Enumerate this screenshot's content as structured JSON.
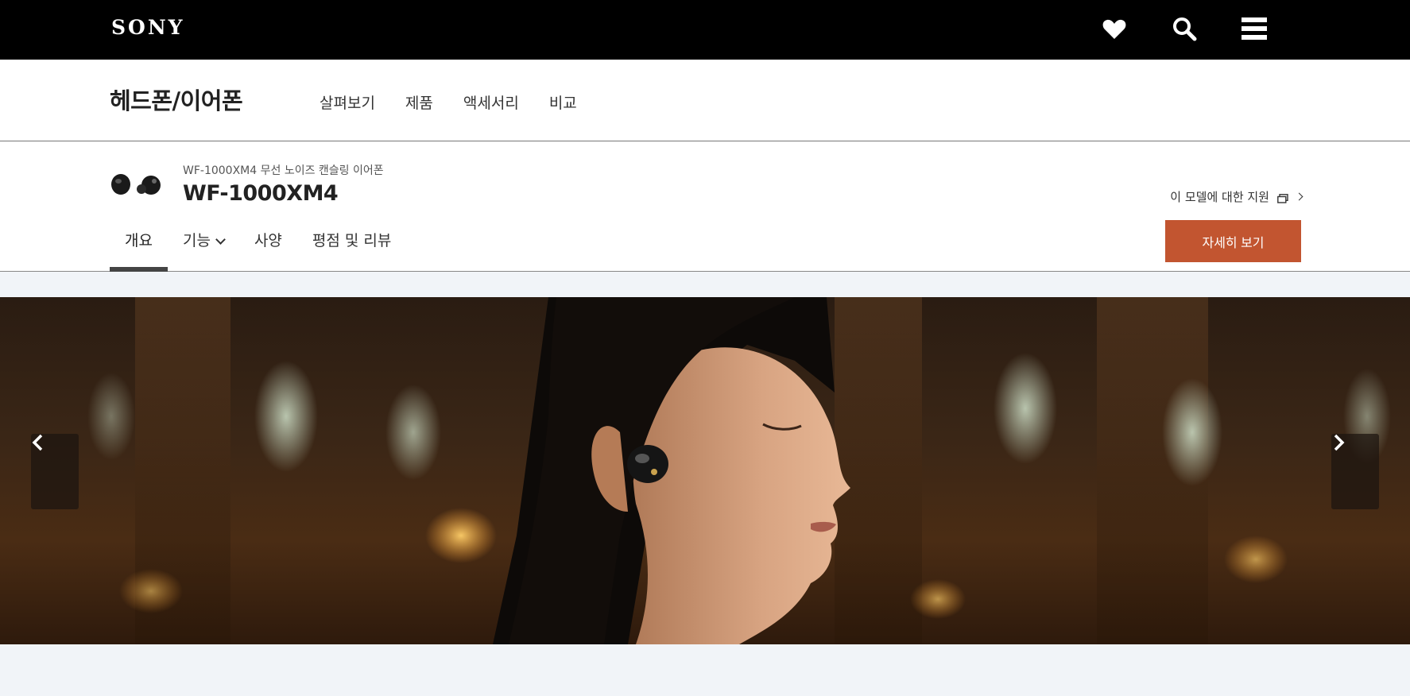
{
  "header": {
    "logo": "SONY",
    "icons": [
      "heart-icon",
      "search-icon",
      "menu-icon"
    ]
  },
  "category": {
    "title": "헤드폰/이어폰",
    "links": [
      "살펴보기",
      "제품",
      "액세서리",
      "비교"
    ]
  },
  "product": {
    "subtitle": "WF-1000XM4 무선 노이즈 캔슬링 이어폰",
    "name": "WF-1000XM4",
    "tabs": [
      "개요",
      "기능",
      "사양",
      "평점 및 리뷰"
    ],
    "active_tab": "개요",
    "support_link": "이 모델에 대한 지원",
    "cta_label": "자세히 보기",
    "cta_color": "#c25530"
  },
  "hero": {
    "prev_icon": "chevron-left-icon",
    "next_icon": "chevron-right-icon"
  }
}
